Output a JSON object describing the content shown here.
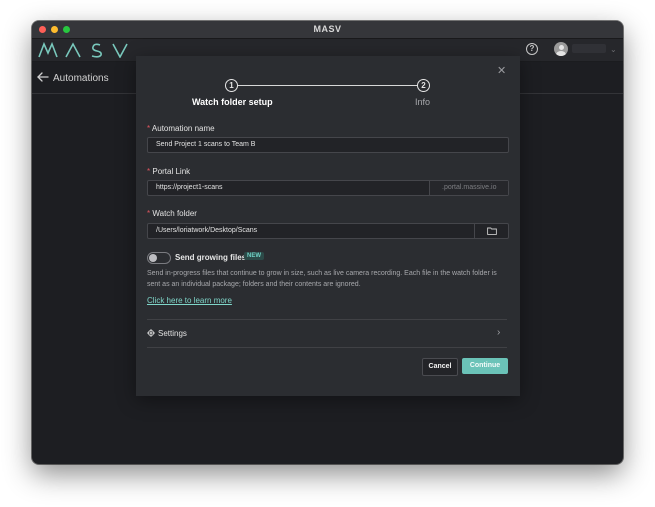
{
  "window": {
    "title": "MASV"
  },
  "header": {
    "help_glyph": "?",
    "user_name": "",
    "user_chevron": "⌄"
  },
  "page": {
    "title": "Automations"
  },
  "dialog": {
    "close_glyph": "✕",
    "steps": [
      {
        "number": "1",
        "label": "Watch folder setup"
      },
      {
        "number": "2",
        "label": "Info"
      }
    ],
    "automation_name": {
      "label": "Automation name",
      "value": "Send Project 1 scans to Team B"
    },
    "portal_link": {
      "label": "Portal Link",
      "value": "https://project1-scans",
      "suffix": ".portal.massive.io"
    },
    "watch_folder": {
      "label": "Watch folder",
      "value": "/Users/loriatwork/Desktop/Scans"
    },
    "growing_files": {
      "label": "Send growing files",
      "badge": "NEW",
      "enabled": false,
      "description": "Send in-progress files that continue to grow in size, such as live camera recording. Each file in the watch folder is sent as an individual package; folders and their contents are ignored.",
      "link": "Click here to learn more"
    },
    "settings": {
      "label": "Settings",
      "chevron": "›"
    },
    "required_mark": "*",
    "cancel_label": "Cancel",
    "continue_label": "Continue"
  },
  "colors": {
    "accent": "#6bc3b8",
    "link": "#7fd6c9",
    "required": "#e0555f",
    "dialog_bg": "#2b2d31",
    "app_bg": "#1d1e22"
  },
  "icons": {
    "close": "close-icon",
    "back": "arrow-left-icon",
    "help": "help-circle-icon",
    "folder": "folder-icon",
    "gear": "gear-icon",
    "chevron": "chevron-right-icon",
    "avatar": "user-avatar-icon"
  }
}
